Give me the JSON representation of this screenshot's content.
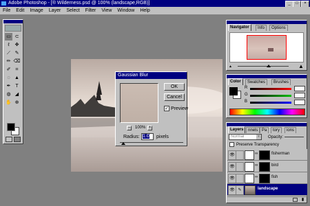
{
  "window": {
    "title": "Adobe Photoshop - [® Wilderness.psd @ 100% (landscape,RGB)]",
    "minimize_glyph": "_",
    "maximize_glyph": "□",
    "close_glyph": "×"
  },
  "menu": [
    "File",
    "Edit",
    "Image",
    "Layer",
    "Select",
    "Filter",
    "View",
    "Window",
    "Help"
  ],
  "toolbox": {
    "tools": [
      "▭",
      "⊂",
      "ℓ",
      "✥",
      "⟋",
      "✎",
      "✏",
      "⌫",
      "✐",
      "⌗",
      "◌",
      "▲",
      "✒",
      "T",
      "◍",
      "◢",
      "✋",
      "⊕"
    ]
  },
  "navigator": {
    "tabs": [
      "Navigator",
      "Info",
      "Options"
    ],
    "zoom": "100%"
  },
  "color_panel": {
    "tabs": [
      "Color",
      "Swatches",
      "Brushes"
    ],
    "channels": [
      {
        "label": "R",
        "value": "",
        "color": "#ff0000"
      },
      {
        "label": "G",
        "value": "",
        "color": "#00a000"
      },
      {
        "label": "B",
        "value": "",
        "color": "#0000ff"
      }
    ]
  },
  "layers": {
    "tabs": [
      "Layers",
      "Channels",
      "Paths",
      "History",
      "Actions"
    ],
    "tabs_visible": [
      "Layers",
      "nnels",
      "Pa",
      "tory",
      "ions"
    ],
    "blend_mode": "Normal",
    "opacity_label": "Opacity:",
    "preserve_label": "Preserve Transparency",
    "rows": [
      {
        "name": "fisherman",
        "active": false
      },
      {
        "name": "bird",
        "active": false
      },
      {
        "name": "fish",
        "active": false
      },
      {
        "name": "landscape",
        "active": true
      }
    ]
  },
  "gaussian_blur": {
    "title": "Gaussian Blur",
    "ok_label": "OK",
    "cancel_label": "Cancel",
    "preview_label": "Preview",
    "preview_checked": "✓",
    "zoom": "100%",
    "zoom_out": "−",
    "zoom_in": "+",
    "radius_label": "Radius:",
    "radius_value": "1.0",
    "units": "pixels"
  },
  "colors": {
    "title_blue": "#000080",
    "chrome": "#c0c0c0",
    "workspace": "#808080"
  }
}
